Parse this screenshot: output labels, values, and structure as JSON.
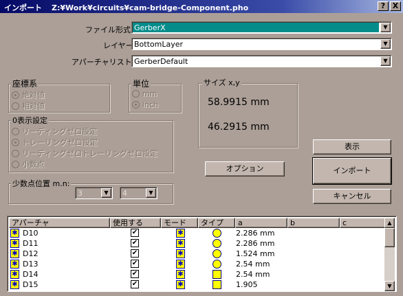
{
  "window": {
    "title_app": "インポート",
    "title_path": "Z:¥Work¥circuits¥cam-bridge-Component.pho",
    "help_button": "?",
    "close_button": "X"
  },
  "fields": {
    "file_format_label": "ファイル形式:",
    "file_format_value": "GerberX",
    "layer_label": "レイヤー:",
    "layer_value": "BottomLayer",
    "aperture_list_label": "アパーチャリスト:",
    "aperture_list_value": "GerberDefault"
  },
  "coordinate_system": {
    "title": "座標系",
    "options": [
      "絶対値",
      "相対値"
    ],
    "selected": 0
  },
  "unit": {
    "title": "単位",
    "options": [
      "mm",
      "inch"
    ],
    "selected": 1
  },
  "size": {
    "title": "サイズ x,y",
    "x": "58.9915 mm",
    "y": "46.2915 mm"
  },
  "zero_display": {
    "title": "0表示設定",
    "options": [
      "リーディングゼロ設定",
      "トレーリングゼロ設定",
      "リーディングゼロトレーリングゼロ設定",
      "小数点"
    ],
    "selected": 1
  },
  "decimal": {
    "title": "少数点位置 m.n:",
    "m": "3",
    "n": "4"
  },
  "buttons": {
    "display": "表示",
    "import": "インポート",
    "options": "オプション",
    "cancel": "キャンセル"
  },
  "list": {
    "columns": [
      "アパーチャ",
      "使用する",
      "モード",
      "タイプ",
      "a",
      "b",
      "c"
    ],
    "rows": [
      {
        "name": "D10",
        "used": true,
        "shape": "circle",
        "a": "2.286  mm"
      },
      {
        "name": "D11",
        "used": true,
        "shape": "circle",
        "a": "2.286  mm"
      },
      {
        "name": "D12",
        "used": true,
        "shape": "circle",
        "a": "1.524  mm"
      },
      {
        "name": "D13",
        "used": true,
        "shape": "circle",
        "a": "2.54  mm"
      },
      {
        "name": "D14",
        "used": true,
        "shape": "square",
        "a": "2.54  mm"
      },
      {
        "name": "D15",
        "used": true,
        "shape": "square",
        "a": "1.905"
      }
    ]
  },
  "colors": {
    "accent": "#048c8b",
    "face": "#ab9f97",
    "title_bar": "#050a66"
  }
}
